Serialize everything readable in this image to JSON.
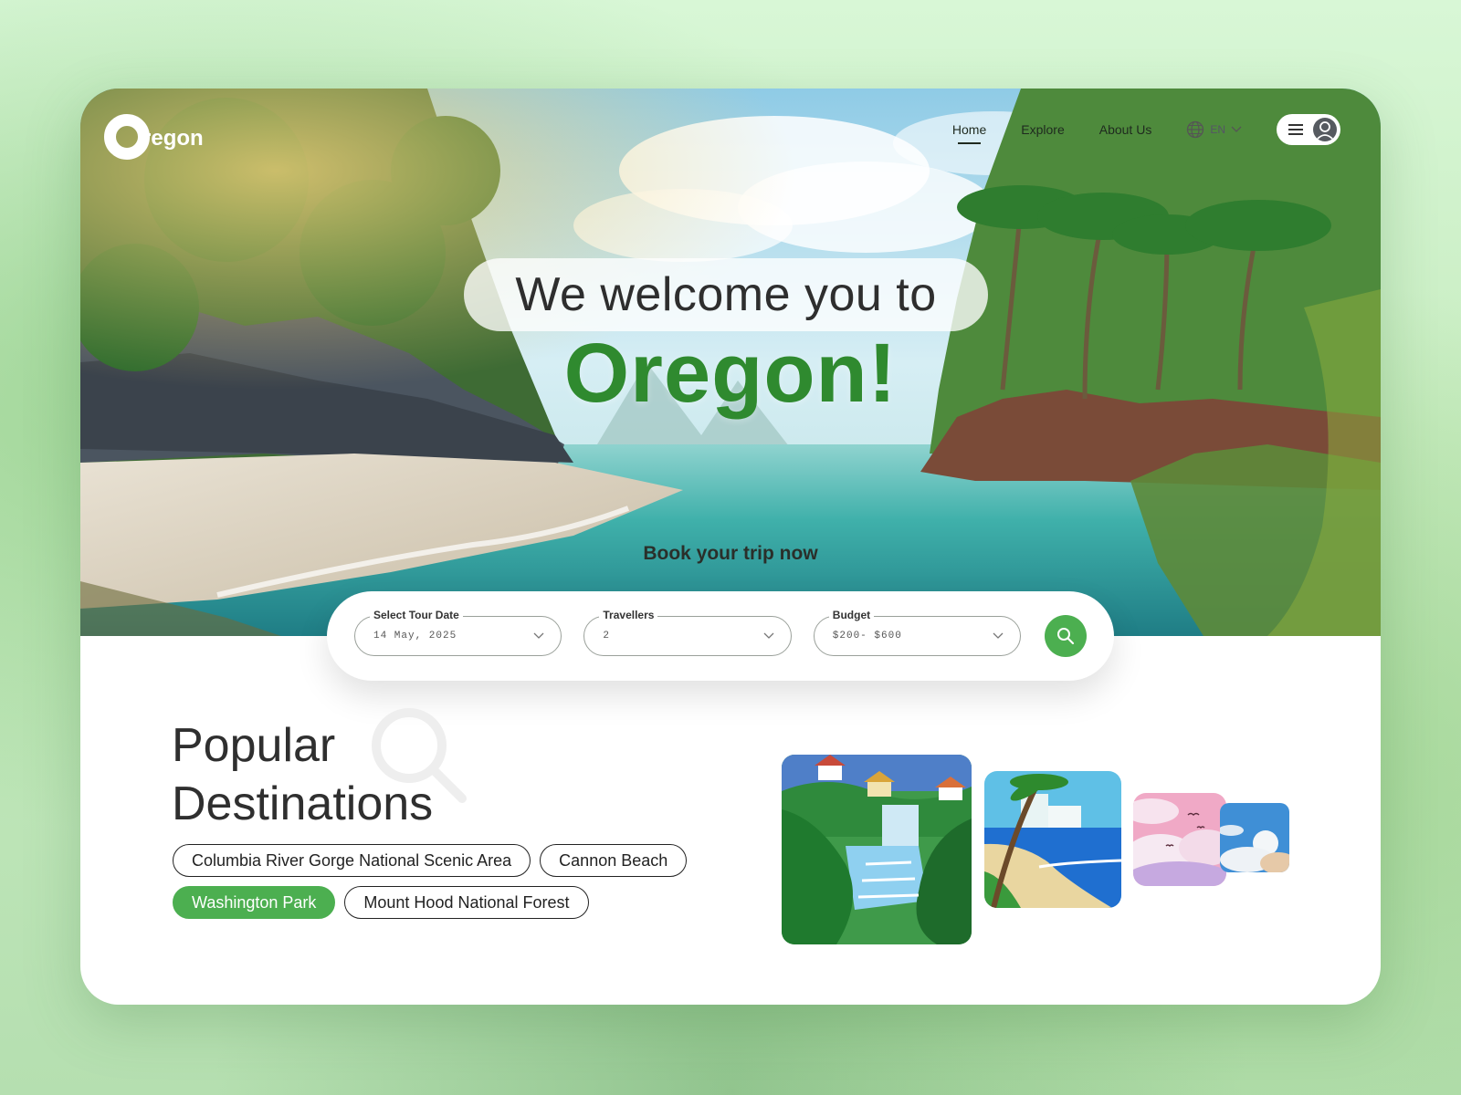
{
  "header": {
    "logo_text": "regon",
    "nav": [
      {
        "label": "Home",
        "active": true
      },
      {
        "label": "Explore",
        "active": false
      },
      {
        "label": "About Us",
        "active": false
      }
    ],
    "language": "EN"
  },
  "hero": {
    "welcome_line": "We welcome you to",
    "title": "Oregon!",
    "cta": "Book your trip now"
  },
  "search": {
    "date": {
      "label": "Select Tour Date",
      "value": "14 May, 2025"
    },
    "travellers": {
      "label": "Travellers",
      "value": "2"
    },
    "budget": {
      "label": "Budget",
      "value": "$200- $600"
    }
  },
  "popular": {
    "title_line1": "Popular",
    "title_line2": "Destinations",
    "tags": [
      {
        "label": "Columbia River Gorge National Scenic Area",
        "active": false
      },
      {
        "label": "Cannon Beach",
        "active": false
      },
      {
        "label": "Washington Park",
        "active": true
      },
      {
        "label": "Mount Hood National Forest",
        "active": false
      }
    ]
  },
  "colors": {
    "accent": "#4caf50",
    "title_green": "#2f8a2f",
    "text_dark": "#2f2f2f"
  },
  "icons": [
    "globe-icon",
    "chevron-down-icon",
    "menu-icon",
    "user-icon",
    "search-icon"
  ]
}
